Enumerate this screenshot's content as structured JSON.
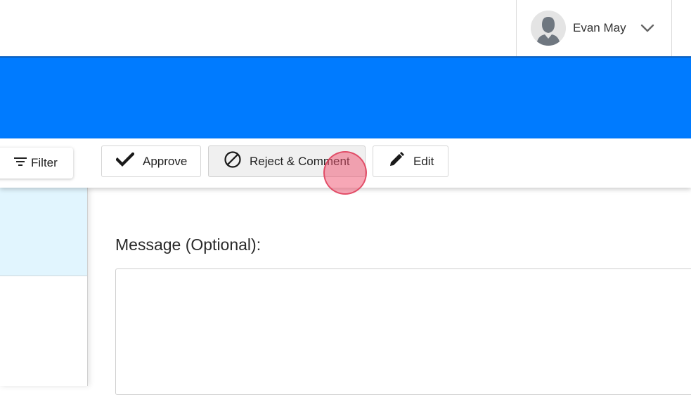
{
  "header": {
    "user": {
      "name": "Evan May",
      "avatar_icon": "user-avatar-icon",
      "menu_icon": "chevron-down-icon"
    }
  },
  "colors": {
    "brand_blue": "#007bff",
    "selected_row": "#e1f5fe",
    "click_indicator": "#f0506e"
  },
  "sidebar": {
    "filter_label": "Filter",
    "filter_icon": "filter-icon"
  },
  "toolbar": {
    "approve_label": "Approve",
    "approve_icon": "checkmark-icon",
    "reject_label": "Reject & Comment",
    "reject_icon": "prohibited-icon",
    "edit_label": "Edit",
    "edit_icon": "pencil-icon"
  },
  "message": {
    "label": "Message (Optional):",
    "value": "",
    "placeholder": ""
  }
}
